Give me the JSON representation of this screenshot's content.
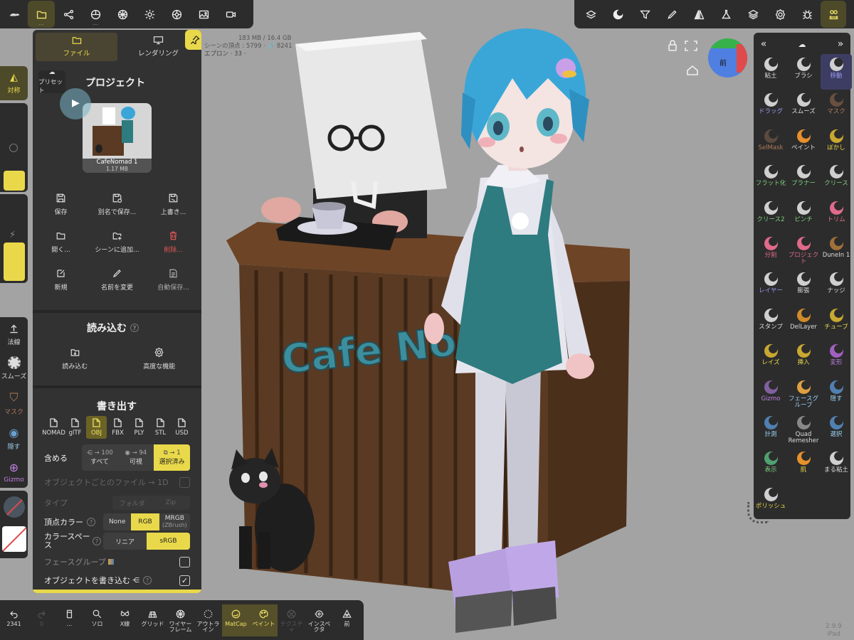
{
  "app": {
    "version": "2.9.9",
    "device": "iPad"
  },
  "colors": {
    "accent": "#e9d94a",
    "panel": "#323232",
    "bar": "#2c2c2c",
    "selected_tool": "#3d3d63",
    "viewport": "#a3a3a3"
  },
  "top_left_icons": [
    "nomad-logo-icon",
    "folder-icon",
    "scene-graph-icon",
    "material-icon",
    "texture-icon",
    "light-icon",
    "camera-settings-icon",
    "background-icon",
    "video-icon"
  ],
  "top_right_icons": [
    "topology-icon",
    "matcap-icon",
    "filter-icon",
    "brush-stroke-icon",
    "symmetry-icon",
    "flask-icon",
    "layers-icon",
    "settings-icon",
    "bug-icon",
    "tools-icon"
  ],
  "stats": {
    "memory": "183 MB / 16.4 GB",
    "vertices": "シーンの頂点 : 5799 · 🔗 8241",
    "object": "エプロン · 33 ·"
  },
  "left_panel": {
    "tabs": {
      "file": "ファイル",
      "render": "レンダリング"
    },
    "project": {
      "title": "プロジェクト",
      "preset": "プリセット",
      "thumb_name": "CafeNomad 1",
      "thumb_size": "1.17 MB"
    },
    "actions": [
      {
        "label": "保存",
        "icon": "save-icon"
      },
      {
        "label": "別名で保存...",
        "icon": "save-as-icon"
      },
      {
        "label": "上書き...",
        "icon": "overwrite-icon"
      },
      {
        "label": "開く...",
        "icon": "open-icon"
      },
      {
        "label": "シーンに追加...",
        "icon": "add-to-scene-icon"
      },
      {
        "label": "削除...",
        "icon": "trash-icon"
      },
      {
        "label": "新規",
        "icon": "new-icon"
      },
      {
        "label": "名前を変更",
        "icon": "rename-icon"
      },
      {
        "label": "自動保存...",
        "icon": "autosave-icon"
      }
    ],
    "import": {
      "title": "読み込む",
      "items": [
        {
          "label": "読み込む",
          "icon": "import-icon"
        },
        {
          "label": "高度な機能",
          "icon": "gear-icon"
        }
      ]
    },
    "export": {
      "title": "書き出す",
      "formats": [
        "NOMAD",
        "glTF",
        "OBJ",
        "FBX",
        "PLY",
        "STL",
        "USD"
      ],
      "selected_format": "OBJ",
      "include_label": "含める",
      "include": [
        {
          "count": "→ 100",
          "label": "すべて"
        },
        {
          "count": "→ 94",
          "label": "可視"
        },
        {
          "count": "→ 1",
          "label": "選択済み"
        }
      ],
      "per_object_label": "オブジェクトごとのファイル → 1D",
      "type_label": "タイプ",
      "type_options": [
        "フォルダ",
        "Zip"
      ],
      "vertex_color_label": "頂点カラー",
      "vertex_color_options": [
        "None",
        "RGB",
        "MRGB",
        "(ZBrush)"
      ],
      "color_space_label": "カラースペース",
      "color_space_options": [
        "リニア",
        "sRGB"
      ],
      "facegroup_label": "フェースグループ",
      "write_objects_label": "オブジェクトを書き込む"
    }
  },
  "left_toolbar": {
    "symmetry": "対称",
    "normal": "法線",
    "smooth": "スムーズ",
    "mask": "マスク",
    "hide": "隠す",
    "gizmo": "Gizmo"
  },
  "right_panel": {
    "tools": [
      {
        "label": "粘土",
        "color": "#ddd",
        "ball": "#cfcfcf"
      },
      {
        "label": "ブラシ",
        "color": "#ddd",
        "ball": "#cfcfcf"
      },
      {
        "label": "移動",
        "color": "#9a9af0",
        "ball": "#cfcfcf"
      },
      {
        "label": "ドラッグ",
        "color": "#9a9af0",
        "ball": "#cfcfcf"
      },
      {
        "label": "スムーズ",
        "color": "#ddd",
        "ball": "#cfcfcf"
      },
      {
        "label": "マスク",
        "color": "#b07a5a",
        "ball": "#6a5040"
      },
      {
        "label": "SelMask",
        "color": "#b07a5a",
        "ball": "#5a4a40"
      },
      {
        "label": "ペイント",
        "color": "#ddd",
        "ball": "#e8902a"
      },
      {
        "label": "ぼかし",
        "color": "#e9d94a",
        "ball": "#c8a830"
      },
      {
        "label": "フラット化",
        "color": "#7fd07f",
        "ball": "#cfcfcf"
      },
      {
        "label": "プラナー",
        "color": "#7fd07f",
        "ball": "#cfcfcf"
      },
      {
        "label": "クリース",
        "color": "#7fd07f",
        "ball": "#cfcfcf"
      },
      {
        "label": "クリース2",
        "color": "#7fd07f",
        "ball": "#cfcfcf"
      },
      {
        "label": "ピンチ",
        "color": "#7fd07f",
        "ball": "#cfcfcf"
      },
      {
        "label": "トリム",
        "color": "#e06a8a",
        "ball": "#e06a8a"
      },
      {
        "label": "分割",
        "color": "#e06a8a",
        "ball": "#e06a8a"
      },
      {
        "label": "プロジェクト",
        "color": "#e06a8a",
        "ball": "#e06a8a"
      },
      {
        "label": "DuneIn 1",
        "color": "#ddd",
        "ball": "#a0703a"
      },
      {
        "label": "レイヤー",
        "color": "#9a9af0",
        "ball": "#cfcfcf"
      },
      {
        "label": "膨張",
        "color": "#ddd",
        "ball": "#cfcfcf"
      },
      {
        "label": "ナッジ",
        "color": "#ddd",
        "ball": "#cfcfcf"
      },
      {
        "label": "スタンプ",
        "color": "#ddd",
        "ball": "#cfcfcf"
      },
      {
        "label": "DelLayer",
        "color": "#ddd",
        "ball": "#d08a2a"
      },
      {
        "label": "チューブ",
        "color": "#e9d94a",
        "ball": "#c8a830"
      },
      {
        "label": "レイズ",
        "color": "#e9d94a",
        "ball": "#c8a830"
      },
      {
        "label": "挿入",
        "color": "#e9d94a",
        "ball": "#c8a830"
      },
      {
        "label": "変形",
        "color": "#c080e0",
        "ball": "#a060c0"
      },
      {
        "label": "Gizmo",
        "color": "#c080e0",
        "ball": "#8060a0"
      },
      {
        "label": "フェースグループ",
        "color": "#9ad0f0",
        "ball": "#e0a040"
      },
      {
        "label": "隠す",
        "color": "#9ad0f0",
        "ball": "#5080b0"
      },
      {
        "label": "計測",
        "color": "#9ad0f0",
        "ball": "#5080b0"
      },
      {
        "label": "Quad Remesher",
        "color": "#ddd",
        "ball": "#888"
      },
      {
        "label": "選択",
        "color": "#9ad0f0",
        "ball": "#5080b0"
      },
      {
        "label": "表示",
        "color": "#7fd07f",
        "ball": "#50a070"
      },
      {
        "label": "肌",
        "color": "#e9d94a",
        "ball": "#e8902a"
      },
      {
        "label": "まる粘土",
        "color": "#ddd",
        "ball": "#cfcfcf"
      },
      {
        "label": "ポリッシュ",
        "color": "#e9d94a",
        "ball": "#cfcfcf"
      }
    ],
    "selected": "移動"
  },
  "bottom_bar": [
    {
      "label": "2341",
      "icon": "undo-icon"
    },
    {
      "label": "0",
      "icon": "redo-icon"
    },
    {
      "label": "...",
      "icon": "device-icon"
    },
    {
      "label": "ソロ",
      "icon": "solo-icon"
    },
    {
      "label": "X線",
      "icon": "xray-icon"
    },
    {
      "label": "グリッド",
      "icon": "grid-icon"
    },
    {
      "label": "ワイヤーフレーム",
      "icon": "wireframe-icon"
    },
    {
      "label": "アウトライン",
      "icon": "outline-icon"
    },
    {
      "label": "MatCap",
      "icon": "matcap-icon"
    },
    {
      "label": "ペイント",
      "icon": "paint-icon"
    },
    {
      "label": "テクスチャ",
      "icon": "texture-off-icon"
    },
    {
      "label": "インスペクタ",
      "icon": "inspector-icon"
    },
    {
      "label": "前",
      "icon": "front-view-icon"
    }
  ],
  "viewport": {
    "cube_label": "前",
    "sign_text": "Cafe No"
  }
}
